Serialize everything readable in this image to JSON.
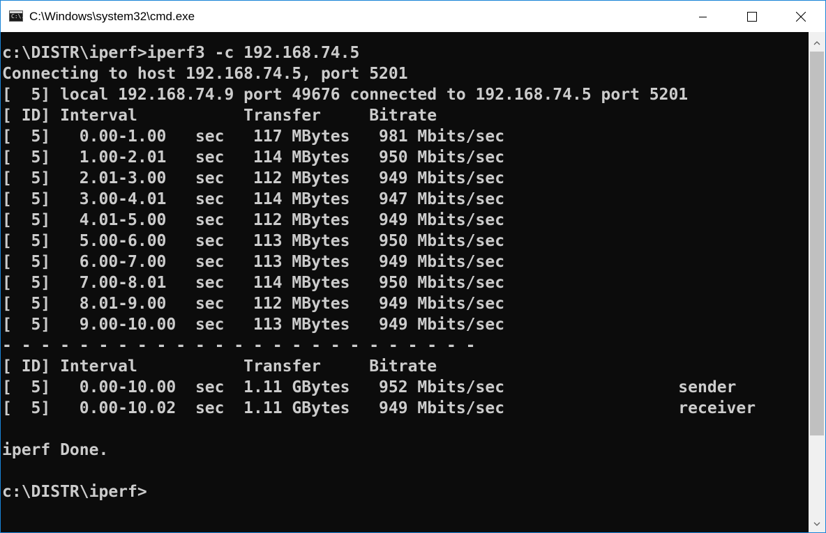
{
  "window": {
    "title": "C:\\Windows\\system32\\cmd.exe",
    "icon_label": "C:\\."
  },
  "controls": {
    "minimize_icon": "minimize-icon",
    "maximize_icon": "maximize-icon",
    "close_icon": "close-icon"
  },
  "console": {
    "lines": [
      "",
      "c:\\DISTR\\iperf>iperf3 -c 192.168.74.5",
      "Connecting to host 192.168.74.5, port 5201",
      "[  5] local 192.168.74.9 port 49676 connected to 192.168.74.5 port 5201",
      "[ ID] Interval           Transfer     Bitrate",
      "[  5]   0.00-1.00   sec   117 MBytes   981 Mbits/sec",
      "[  5]   1.00-2.01   sec   114 MBytes   950 Mbits/sec",
      "[  5]   2.01-3.00   sec   112 MBytes   949 Mbits/sec",
      "[  5]   3.00-4.01   sec   114 MBytes   947 Mbits/sec",
      "[  5]   4.01-5.00   sec   112 MBytes   949 Mbits/sec",
      "[  5]   5.00-6.00   sec   113 MBytes   950 Mbits/sec",
      "[  5]   6.00-7.00   sec   113 MBytes   949 Mbits/sec",
      "[  5]   7.00-8.01   sec   114 MBytes   950 Mbits/sec",
      "[  5]   8.01-9.00   sec   112 MBytes   949 Mbits/sec",
      "[  5]   9.00-10.00  sec   113 MBytes   949 Mbits/sec",
      "- - - - - - - - - - - - - - - - - - - - - - - - -",
      "[ ID] Interval           Transfer     Bitrate",
      "[  5]   0.00-10.00  sec  1.11 GBytes   952 Mbits/sec                  sender",
      "[  5]   0.00-10.02  sec  1.11 GBytes   949 Mbits/sec                  receiver",
      "",
      "iperf Done.",
      "",
      "c:\\DISTR\\iperf>"
    ]
  },
  "colors": {
    "console_bg": "#0c0c0c",
    "console_text": "#cccccc",
    "titlebar_bg": "#ffffff",
    "window_border": "#1883d7"
  },
  "scrollbar": {
    "up_icon": "scroll-up-arrow-icon",
    "down_icon": "scroll-down-arrow-icon"
  }
}
